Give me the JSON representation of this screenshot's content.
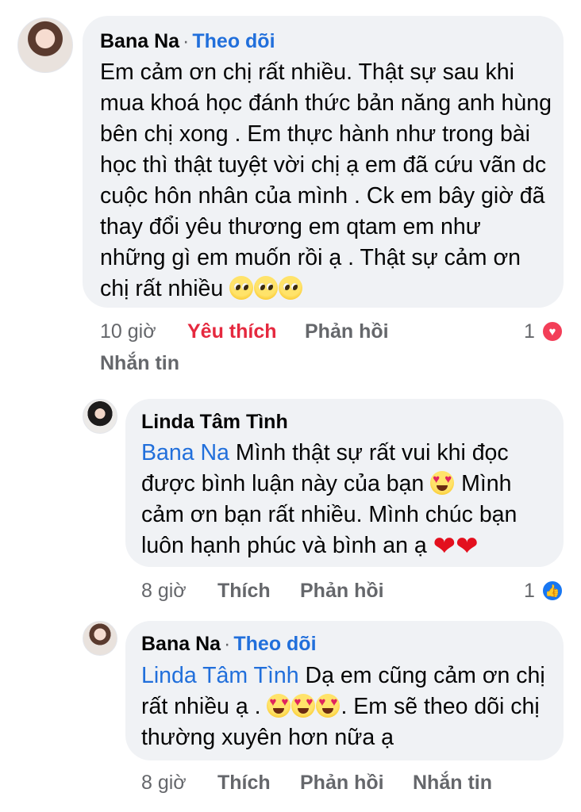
{
  "comments": [
    {
      "author": "Bana Na",
      "follow_label": "Theo dõi",
      "separator": "·",
      "text": "Em cảm ơn chị rất nhiều. Thật sự sau khi mua khoá học đánh thức bản năng anh hùng bên chị xong . Em thực hành như trong bài học thì thật tuyệt vời chị ạ em đã cứu vãn dc cuộc hôn nhân của mình . Ck em bây giờ đã thay đổi yêu thương em qtam em như những gì em muốn rồi ạ . Thật sự cảm ơn chị rất nhiều",
      "time": "10 giờ",
      "like_label": "Yêu thích",
      "reply_label": "Phản hồi",
      "message_label": "Nhắn tin",
      "reaction_count": "1",
      "reaction_icon": "love-reaction-icon"
    },
    {
      "author": "Linda Tâm Tình",
      "mention": "Bana Na",
      "text_1": " Mình thật sự rất vui khi đọc được bình luận này của bạn ",
      "text_2": " Mình cảm ơn bạn rất nhiều. Mình chúc bạn luôn hạnh phúc và bình an ạ ",
      "time": "8 giờ",
      "like_label": "Thích",
      "reply_label": "Phản hồi",
      "reaction_count": "1",
      "reaction_icon": "like-reaction-icon"
    },
    {
      "author": "Bana Na",
      "follow_label": "Theo dõi",
      "separator": "·",
      "mention": "Linda Tâm Tình",
      "text_1": " Dạ em cũng cảm ơn chị rất nhiều ạ . ",
      "text_2": ". Em sẽ theo dõi chị thường xuyên hơn nữa ạ",
      "time": "8 giờ",
      "like_label": "Thích",
      "reply_label": "Phản hồi",
      "message_label": "Nhắn tin"
    }
  ],
  "colors": {
    "link": "#216fdb",
    "liked": "#e5293f",
    "bubble": "#f0f2f5",
    "meta": "#65676b"
  }
}
